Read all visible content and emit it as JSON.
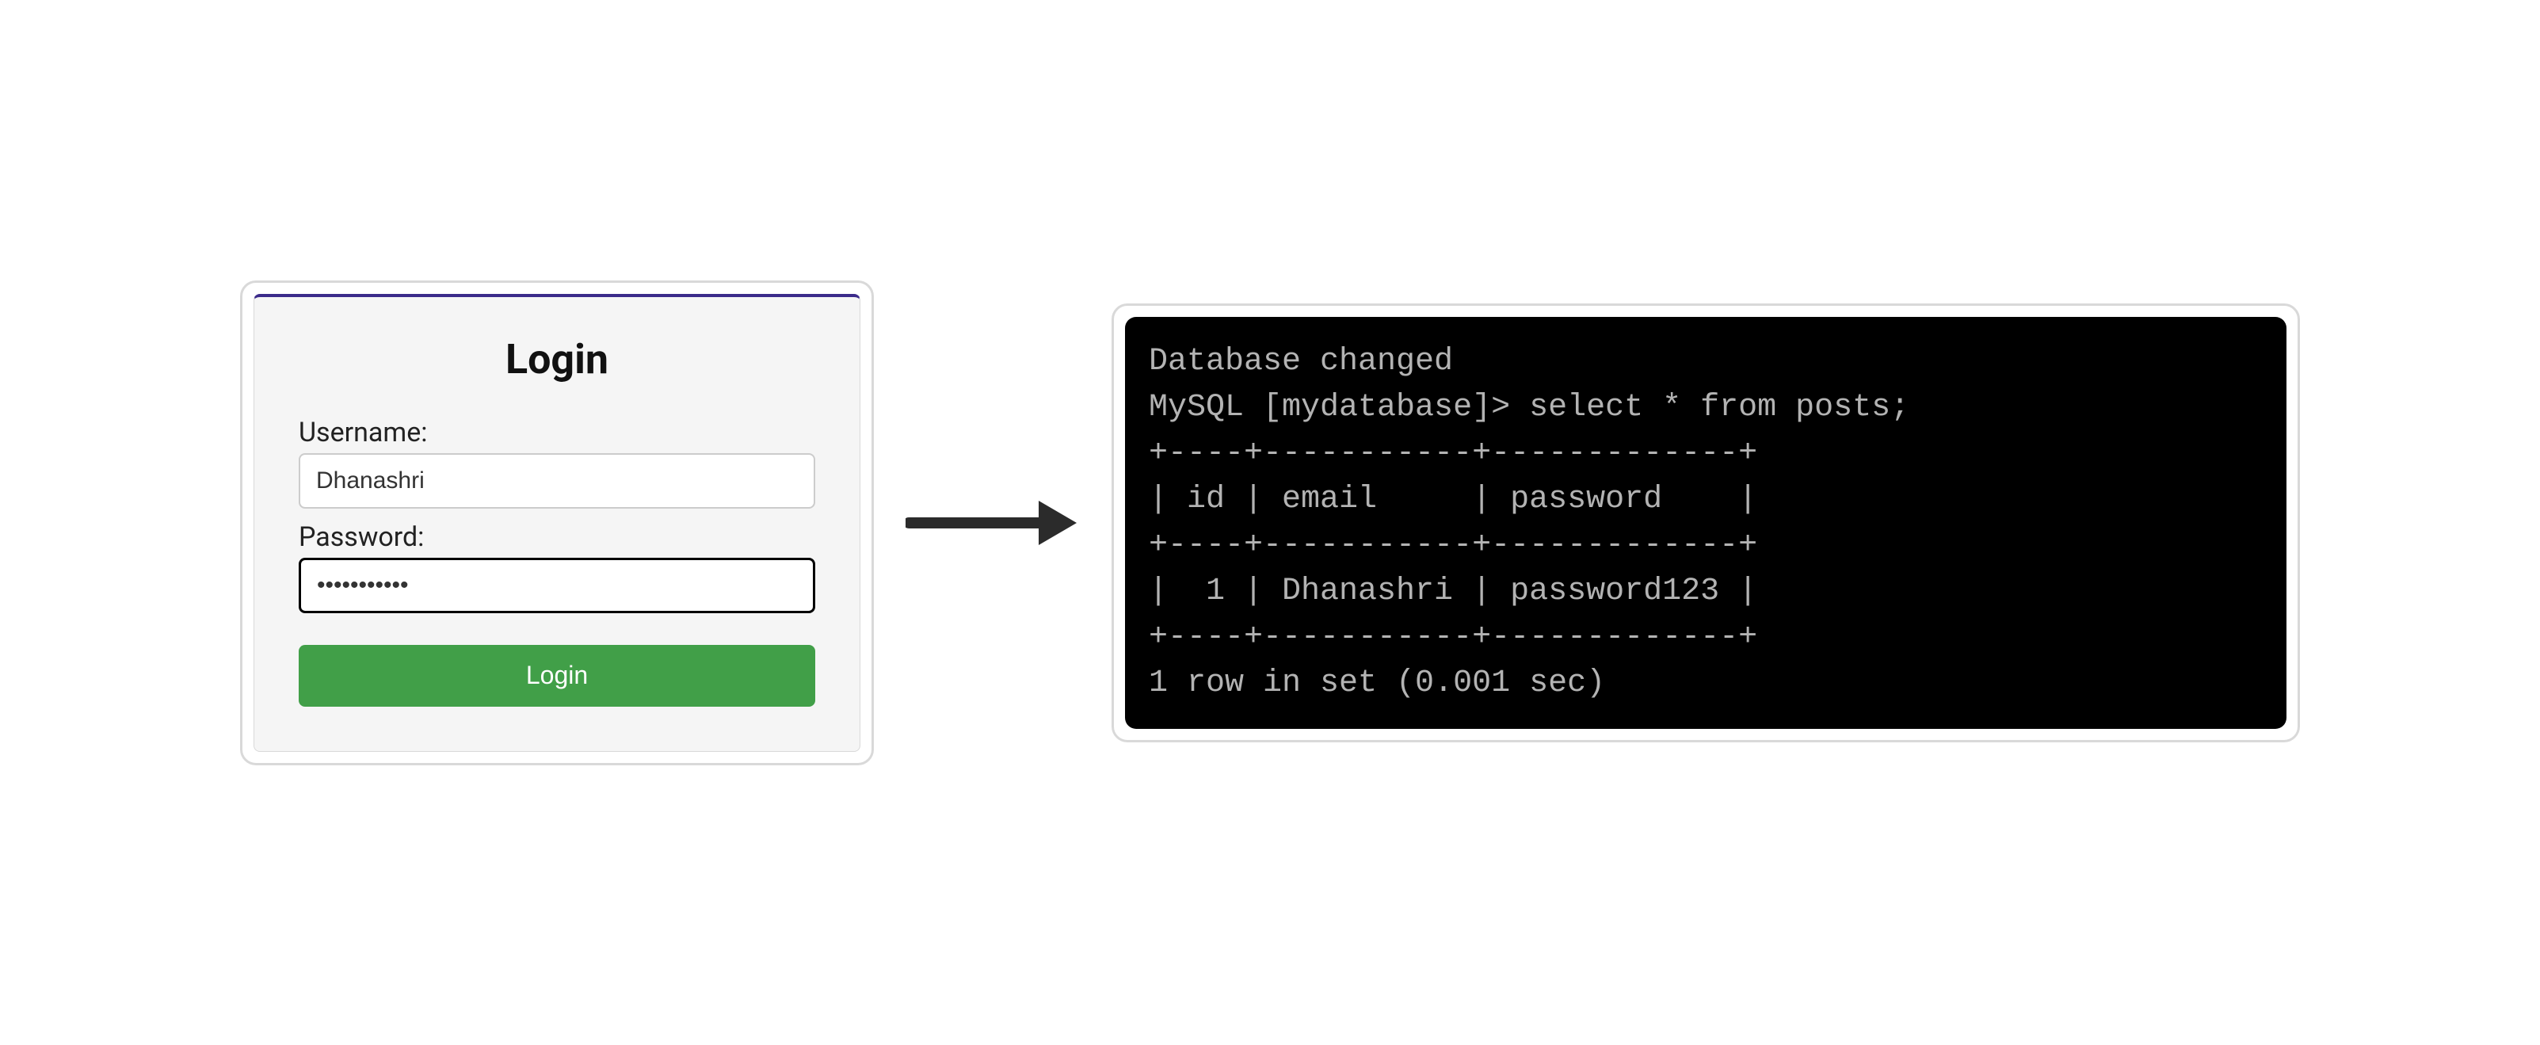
{
  "left": {
    "title": "Login",
    "username_label": "Username:",
    "username_value": "Dhanashri",
    "password_label": "Password:",
    "password_masked": "•••••••••••",
    "login_button": "Login"
  },
  "terminal": {
    "lines": [
      "Database changed",
      "MySQL [mydatabase]> select * from posts;",
      "+----+-----------+-------------+",
      "| id | email     | password    |",
      "+----+-----------+-------------+",
      "|  1 | Dhanashri | password123 |",
      "+----+-----------+-------------+",
      "1 row in set (0.001 sec)"
    ]
  },
  "arrow": {
    "color": "#2b2b2b"
  }
}
